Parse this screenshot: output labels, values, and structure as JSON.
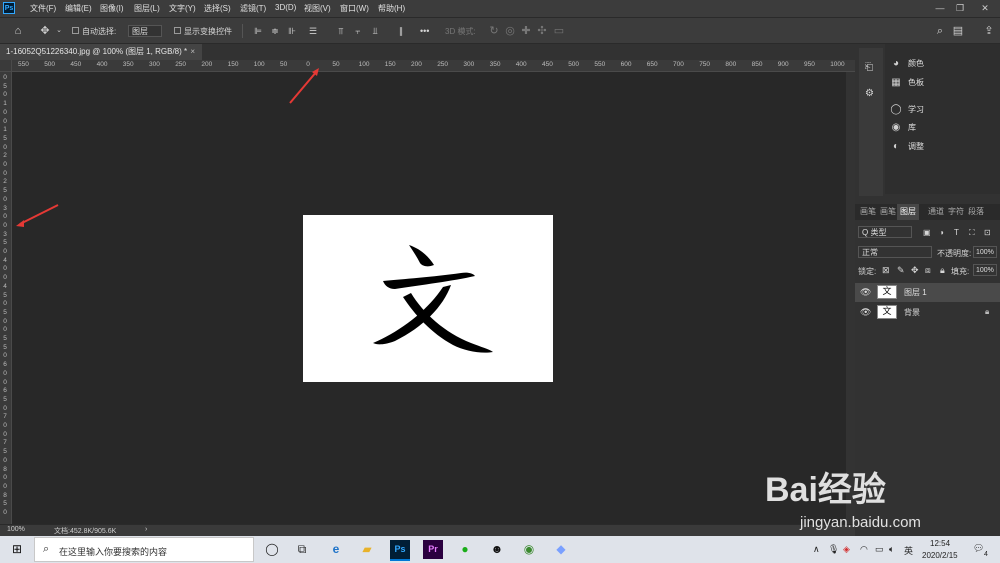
{
  "app": {
    "logo": "Ps",
    "menu": [
      "文件(F)",
      "编辑(E)",
      "图像(I)",
      "图层(L)",
      "文字(Y)",
      "选择(S)",
      "滤镜(T)",
      "3D(D)",
      "视图(V)",
      "窗口(W)",
      "帮助(H)"
    ],
    "window_controls": [
      "—",
      "❐",
      "✕"
    ]
  },
  "options_bar": {
    "auto_select_label": "自动选择:",
    "auto_select_value": "图层",
    "show_transform_label": "显示变换控件",
    "mode_3d_label": "3D 模式:",
    "more": "•••"
  },
  "document": {
    "tab_title": "1-16052Q51226340.jpg @ 100% (图层 1, RGB/8) *",
    "tab_close": "×",
    "canvas_text": "文",
    "bg_color": "#ffffff"
  },
  "rulers": {
    "horizontal": [
      "550",
      "500",
      "450",
      "400",
      "350",
      "300",
      "250",
      "200",
      "150",
      "100",
      "50",
      "0",
      "50",
      "100",
      "150",
      "200",
      "250",
      "300",
      "350",
      "400",
      "450",
      "500",
      "550",
      "600",
      "650",
      "700",
      "750",
      "800",
      "850",
      "900",
      "950",
      "1000"
    ],
    "vertical": [
      "0",
      "5",
      "0",
      "1",
      "0",
      "0",
      "1",
      "5",
      "0",
      "2",
      "0",
      "0",
      "2",
      "5",
      "0",
      "3",
      "0",
      "0",
      "3",
      "5",
      "0",
      "4",
      "0",
      "0",
      "4",
      "5",
      "0",
      "5",
      "0",
      "0",
      "5",
      "5",
      "0",
      "6",
      "0",
      "0",
      "6",
      "5",
      "0",
      "7",
      "0",
      "0",
      "7",
      "5",
      "0",
      "8",
      "0",
      "0",
      "8",
      "5",
      "0"
    ]
  },
  "status": {
    "zoom": "100%",
    "doc_info": "文档:452.8K/905.6K",
    "arrow": "›"
  },
  "right_panel": {
    "panels": [
      {
        "label": "颜色",
        "icon": "palette-icon"
      },
      {
        "label": "色板",
        "icon": "grid-icon"
      },
      {
        "label": "学习",
        "icon": "bulb-icon"
      },
      {
        "label": "库",
        "icon": "library-icon"
      },
      {
        "label": "调整",
        "icon": "adjust-icon"
      }
    ],
    "layer_tabs": [
      "画笔",
      "画笔",
      "图层",
      "通道",
      "字符",
      "段落"
    ],
    "active_tab_index": 2,
    "filter_label": "Q 类型",
    "blend_mode": "正常",
    "opacity_label": "不透明度:",
    "opacity_value": "100%",
    "lock_label": "锁定:",
    "fill_label": "填充:",
    "fill_value": "100%",
    "layers": [
      {
        "name": "图层 1",
        "thumb": "文",
        "selected": true
      },
      {
        "name": "背景",
        "thumb": "文",
        "selected": false
      }
    ]
  },
  "taskbar": {
    "search_placeholder": "在这里输入你要搜索的内容",
    "time": "12:54",
    "date": "2020/2/15",
    "ime": "英",
    "notification_count": "4"
  },
  "watermark": {
    "brand": "Bai经验",
    "url": "jingyan.baidu.com"
  }
}
